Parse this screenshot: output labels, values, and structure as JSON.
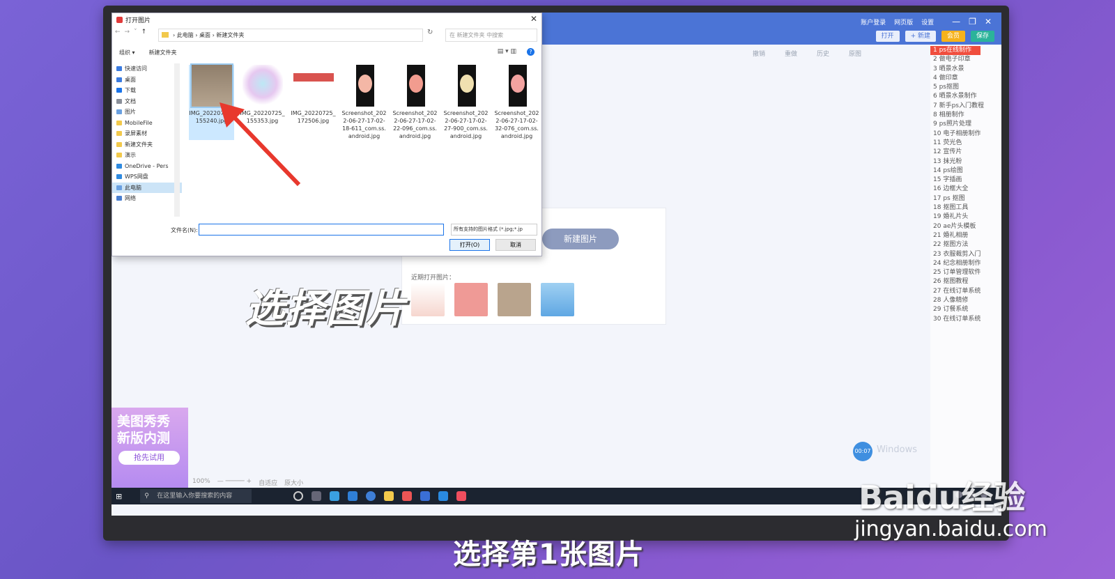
{
  "app": {
    "header_links": [
      "账户登录",
      "网页版",
      "设置"
    ],
    "buttons": {
      "open": "打开",
      "new": "+ 新建",
      "vip": "会员",
      "save": "保存"
    },
    "toolbar": [
      "撤销",
      "重做",
      "历史",
      "原图"
    ],
    "right_list": [
      "1 ps在线制作",
      "2 做电子印章",
      "3 晒景水景",
      "4 做印章",
      "5 ps抠图",
      "6 晒景水景制作",
      "7 新手ps入门教程",
      "8 相册制作",
      "9 ps照片处理",
      "10 电子相册制作",
      "11 荧光色",
      "12 宣传片",
      "13 抹光粉",
      "14 ps绘图",
      "15 字插画",
      "16 边框大全",
      "17 ps 抠图",
      "18 抠图工具",
      "19 婚礼片头",
      "20 ae片头模板",
      "21 婚礼相册",
      "22 抠图方法",
      "23 衣服裁剪入门",
      "24 纪念相册制作",
      "25 订单管理软件",
      "26 抠图教程",
      "27 在线订单系统",
      "28 人像精修",
      "29 订餐系统",
      "30 在线订单系统"
    ],
    "new_image_btn": "新建图片",
    "recent_label": "近期打开图片：",
    "promo": {
      "line1": "美图秀秀",
      "line2": "新版内测",
      "cta": "抢先试用"
    },
    "zoom": {
      "value": "100%",
      "fit": "自适应",
      "original": "原大小"
    },
    "taskbar_search": "在这里输入你要搜索的内容",
    "windows_watermark": "Windows",
    "timer": "00:07"
  },
  "dialog": {
    "title": "打开图片",
    "breadcrumb": [
      "此电脑",
      "桌面",
      "新建文件夹"
    ],
    "search_placeholder": "在 新建文件夹 中搜索",
    "organize": "组织 ▾",
    "new_folder": "新建文件夹",
    "nav": [
      "快速访问",
      "桌面",
      "下载",
      "文档",
      "图片",
      "MobileFile",
      "录屏素材",
      "新建文件夹",
      "演示",
      "OneDrive - Pers",
      "WPS网盘",
      "此电脑",
      "网络"
    ],
    "files": [
      {
        "name": "IMG_20220725_155240.jpg",
        "selected": true
      },
      {
        "name": "IMG_20220725_155353.jpg"
      },
      {
        "name": "IMG_20220725_172506.jpg"
      },
      {
        "name": "Screenshot_2022-06-27-17-02-18-611_com.ss.android.jpg"
      },
      {
        "name": "Screenshot_2022-06-27-17-02-22-096_com.ss.android.jpg"
      },
      {
        "name": "Screenshot_2022-06-27-17-02-27-900_com.ss.android.jpg"
      },
      {
        "name": "Screenshot_2022-06-27-17-02-32-076_com.ss.android.jpg"
      }
    ],
    "filename_label": "文件名(N):",
    "filename_value": "",
    "filetype": "所有支持的图片格式 (*.jpg;*.jp",
    "open_btn": "打开(O)",
    "cancel_btn": "取消"
  },
  "overlay": {
    "caption": "选择图片",
    "subtitle": "选择第1张图片",
    "baidu": "Baidu经验",
    "baidu_url": "jingyan.baidu.com"
  }
}
